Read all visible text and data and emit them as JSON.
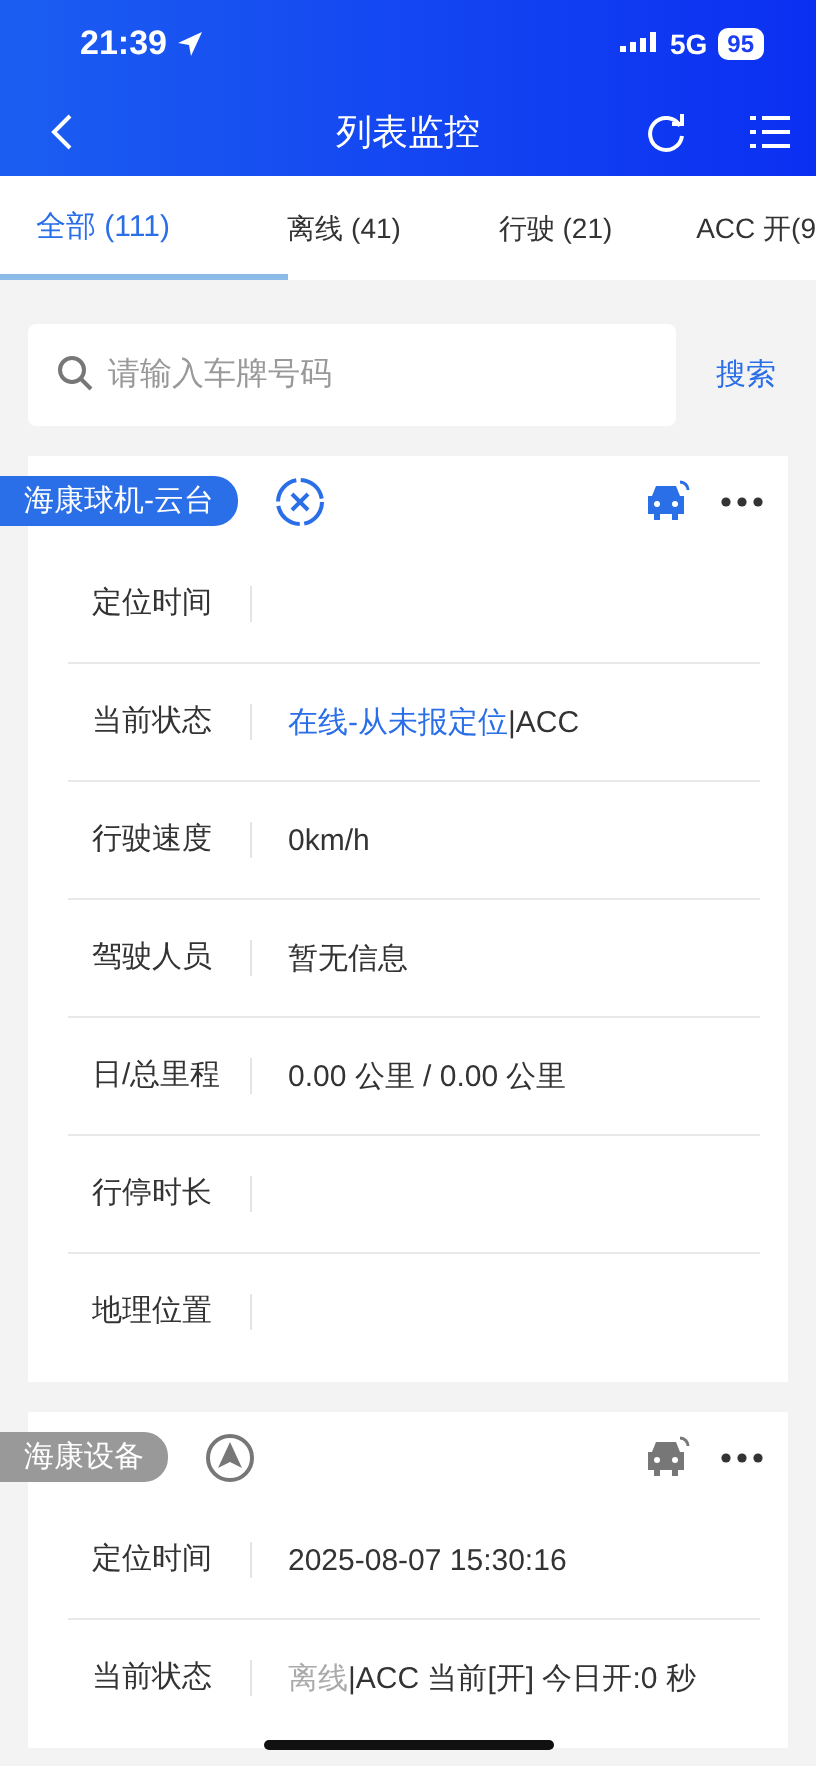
{
  "status_bar": {
    "time": "21:39",
    "network": "5G",
    "battery": "95"
  },
  "nav": {
    "title": "列表监控"
  },
  "tabs": [
    {
      "label": "全部 (111)",
      "selected": true
    },
    {
      "label": "离线 (41)",
      "selected": false
    },
    {
      "label": "行驶 (21)",
      "selected": false
    },
    {
      "label": "ACC 开(9",
      "selected": false
    }
  ],
  "search": {
    "placeholder": "请输入车牌号码",
    "button": "搜索"
  },
  "vehicles": [
    {
      "name": "海康球机-云台",
      "online": true,
      "located": false,
      "rows": [
        {
          "label": "定位时间",
          "value": ""
        },
        {
          "label": "当前状态",
          "status": "在线-从未报定位",
          "value": "|ACC"
        },
        {
          "label": "行驶速度",
          "value": "0km/h"
        },
        {
          "label": "驾驶人员",
          "value": "暂无信息"
        },
        {
          "label": "日/总里程",
          "value": "0.00 公里 / 0.00 公里"
        },
        {
          "label": "行停时长",
          "value": ""
        },
        {
          "label": "地理位置",
          "value": ""
        }
      ]
    },
    {
      "name": "海康设备",
      "online": false,
      "located": true,
      "rows": [
        {
          "label": "定位时间",
          "value": "2025-08-07 15:30:16"
        },
        {
          "label": "当前状态",
          "status": "离线",
          "value": "|ACC 当前[开] 今日开:0 秒"
        }
      ]
    }
  ]
}
